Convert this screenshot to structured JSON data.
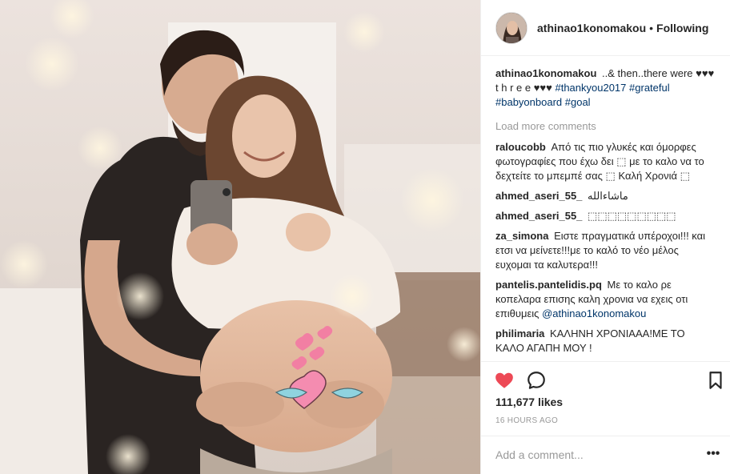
{
  "post": {
    "username": "athinao1konomakou",
    "separator": "•",
    "follow_status": "Following",
    "avatar_icon": "profile-avatar",
    "photo_subject": "couple-pregnancy-photo"
  },
  "caption": {
    "username": "athinao1konomakou",
    "text": "..& then..there were ♥♥♥ t h r e e ♥♥♥",
    "hashtags": [
      "#thankyou2017",
      "#grateful",
      "#babyonboard",
      "#goal"
    ]
  },
  "load_more_label": "Load more comments",
  "comments": [
    {
      "username": "raloucobb",
      "text": "Από τις πιο γλυκές και όμορφες φωτογραφίες που έχω δει ⬚ με το καλο να το δεχτείτε το μπεμπέ σας ⬚ Καλή Χρονιά ⬚"
    },
    {
      "username": "ahmed_aseri_55_",
      "text": "ماشاءالله"
    },
    {
      "username": "ahmed_aseri_55_",
      "text": "⬚⬚⬚⬚⬚⬚⬚⬚⬚"
    },
    {
      "username": "za_simona",
      "text": "Ειστε πραγματικά υπέροχοι!!! και ετσι να μείνετε!!!με το καλό το νέο μέλος ευχομαι τα καλυτερα!!!"
    },
    {
      "username": "pantelis.pantelidis.pq",
      "text": "Με το καλο ρε κοπελαρα επισης καλη χρονια να εχεις οτι επιθυμεις",
      "mention": "@athinao1konomakou"
    },
    {
      "username": "philimaria",
      "text": "ΚΑΛΗΝΗ ΧΡΟΝΙΑΑΑ!ΜΕ ΤΟ ΚΑΛΟ ΑΓΑΠΗ ΜΟΥ !"
    }
  ],
  "actions": {
    "like_icon": "heart-icon",
    "comment_icon": "comment-icon",
    "save_icon": "bookmark-icon",
    "like_color": "#ed4956"
  },
  "likes_text": "111,677 likes",
  "time_text": "16 HOURS AGO",
  "add_comment": {
    "placeholder": "Add a comment...",
    "more_label": "•••"
  }
}
